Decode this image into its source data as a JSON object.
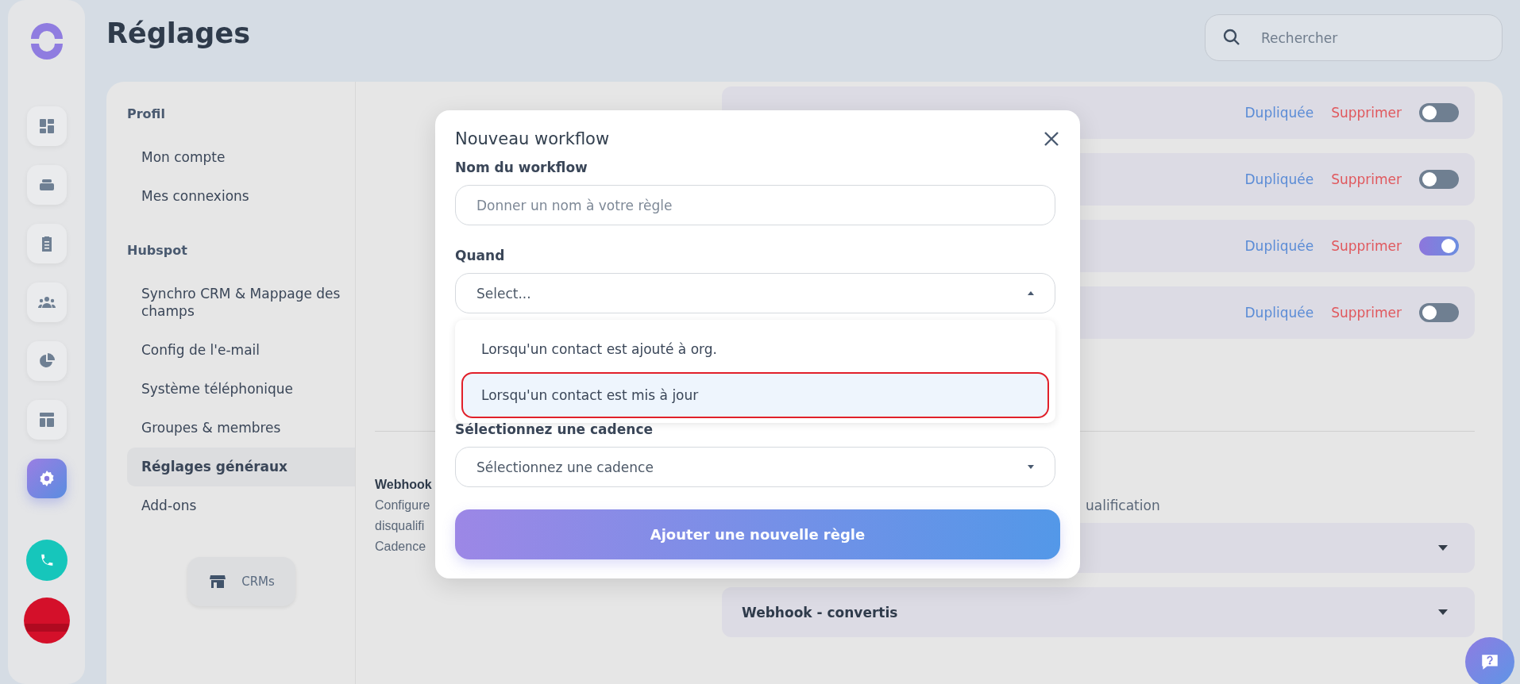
{
  "app": {
    "nav_icons": [
      {
        "kind": "dashboard",
        "selected": false
      },
      {
        "kind": "inbox",
        "selected": false
      },
      {
        "kind": "clipboard",
        "selected": false
      },
      {
        "kind": "people",
        "selected": false
      },
      {
        "kind": "pie",
        "selected": false
      },
      {
        "kind": "layout",
        "selected": false
      },
      {
        "kind": "settings",
        "selected": true
      }
    ]
  },
  "page": {
    "title": "Réglages"
  },
  "search": {
    "placeholder": "Rechercher"
  },
  "settings_nav": {
    "sections": [
      {
        "heading": "Profil",
        "items": [
          {
            "label": "Mon compte",
            "selected": false
          },
          {
            "label": "Mes connexions",
            "selected": false
          }
        ]
      },
      {
        "heading": "Hubspot",
        "items": [
          {
            "label": "Synchro CRM & Mappage des champs",
            "selected": false
          },
          {
            "label": "Config de l'e-mail",
            "selected": false
          },
          {
            "label": "Système téléphonique",
            "selected": false
          },
          {
            "label": "Groupes & membres",
            "selected": false
          },
          {
            "label": "Réglages généraux",
            "selected": true
          },
          {
            "label": "Add-ons",
            "selected": false
          }
        ]
      }
    ],
    "crm_button": "CRMs"
  },
  "workflows": [
    {
      "duplicate": "Dupliquée",
      "delete": "Supprimer",
      "on": false
    },
    {
      "duplicate": "Dupliquée",
      "delete": "Supprimer",
      "on": false
    },
    {
      "duplicate": "Dupliquée",
      "delete": "Supprimer",
      "on": true
    },
    {
      "duplicate": "Dupliquée",
      "delete": "Supprimer",
      "on": false
    }
  ],
  "webhooks": {
    "title": "Webhook",
    "description_lines": [
      "Configure",
      "disqualifi",
      "Cadence"
    ],
    "right_fragment": "ualification",
    "accordions": [
      {
        "kind": "covered"
      },
      {
        "kind": "titled",
        "title": "Webhook - convertis"
      }
    ]
  },
  "modal": {
    "title": "Nouveau workflow",
    "fields": [
      {
        "kind": "text",
        "label": "Nom du workflow",
        "placeholder": "Donner un nom à votre règle"
      },
      {
        "kind": "select",
        "label": "Quand",
        "placeholder": "Select...",
        "expanded": true,
        "options": [
          {
            "label": "Lorsqu'un contact est ajouté à org.",
            "selected": false
          },
          {
            "label": "Lorsqu'un contact est mis à jour",
            "selected": true
          }
        ]
      },
      {
        "kind": "select",
        "label": "Sélectionnez une cadence",
        "placeholder": "Sélectionnez une cadence",
        "expanded": false
      }
    ],
    "submit": "Ajouter une nouvelle règle"
  }
}
